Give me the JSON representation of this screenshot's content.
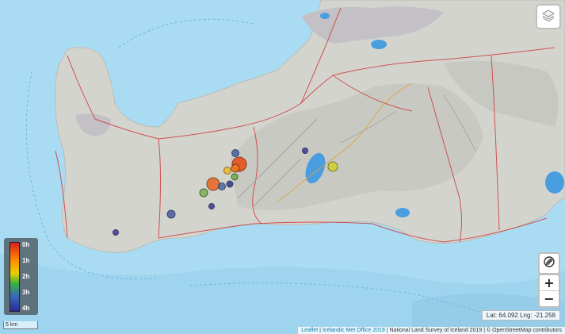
{
  "controls": {
    "layers_icon": "layers-icon",
    "share_icon": "location-share-icon",
    "zoom_in_label": "+",
    "zoom_out_label": "−"
  },
  "coordinates": {
    "text": "Lat: 64.092 Lng: -21.258"
  },
  "legend": {
    "ticks": [
      "0h",
      "1h",
      "2h",
      "3h",
      "4h"
    ],
    "colors": [
      "#d82020",
      "#ff8a00",
      "#e6d000",
      "#38b040",
      "#2a2a9a"
    ]
  },
  "scale": {
    "label": "5 km"
  },
  "attribution": {
    "leaflet": "Leaflet",
    "sep1": " | ",
    "imo": "Icelandic Met Office 2019",
    "rest": " | National Land Survey of Iceland 2019 | © OpenStreetMap contributors"
  },
  "colors": {
    "water": "#a9dcf2",
    "land": "#d4d4cf",
    "road": "#cf3a3a",
    "lake": "#4a9ee0"
  },
  "earthquakes": [
    {
      "hours_ago": 0.1,
      "color": "#e8501a"
    },
    {
      "hours_ago": 0.2,
      "color": "#e86420"
    },
    {
      "hours_ago": 0.6,
      "color": "#f07a1a"
    },
    {
      "hours_ago": 1.3,
      "color": "#f0b820"
    },
    {
      "hours_ago": 1.8,
      "color": "#d0d030"
    },
    {
      "hours_ago": 2.3,
      "color": "#6ab040"
    },
    {
      "hours_ago": 2.6,
      "color": "#7ab050"
    },
    {
      "hours_ago": 3.2,
      "color": "#4060b0"
    },
    {
      "hours_ago": 3.6,
      "color": "#4a58a8"
    },
    {
      "hours_ago": 3.8,
      "color": "#3a3a9a"
    }
  ]
}
